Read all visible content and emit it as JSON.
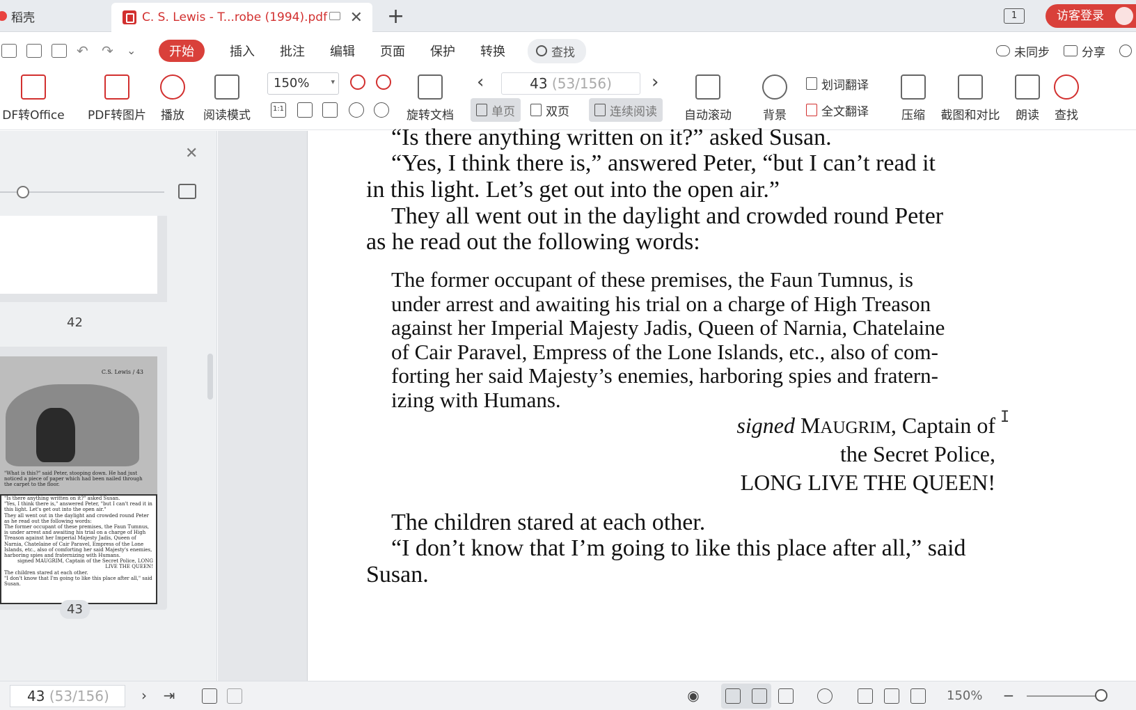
{
  "tabs": {
    "home_label": "稻壳",
    "doc_label": "C. S. Lewis - T...robe (1994).pdf",
    "new_tab_symbol": "+"
  },
  "account": {
    "login_label": "访客登录",
    "layout_badge": "1"
  },
  "menu": {
    "items": [
      "开始",
      "插入",
      "批注",
      "编辑",
      "页面",
      "保护",
      "转换"
    ],
    "search_label": "查找",
    "sync_label": "未同步",
    "share_label": "分享"
  },
  "toolbar": {
    "pdf_to_office": "DF转Office",
    "pdf_to_image": "PDF转图片",
    "play": "播放",
    "reading_mode": "阅读模式",
    "zoom_value": "150%",
    "rotate_doc": "旋转文档",
    "page_current": "43",
    "page_total": "(53/156)",
    "single_page": "单页",
    "double_page": "双页",
    "continuous": "连续阅读",
    "auto_scroll": "自动滚动",
    "background": "背景",
    "word_translate": "划词翻译",
    "full_translate": "全文翻译",
    "compress": "压缩",
    "screenshot_compare": "截图和对比",
    "read_aloud": "朗读",
    "find": "查找"
  },
  "sidebar": {
    "page_42_label": "42",
    "page_43_label": "43",
    "thumb_header": "C.S. Lewis / 43",
    "thumb_caption": "\"What is this?\" said Peter, stooping down. He had just noticed a piece of paper which had been nailed through the carpet to the floor.",
    "thumb_lines": [
      "\"Is there anything written on it?\" asked Susan.",
      "\"Yes, I think there is,\" answered Peter, \"but I can't read it in this light. Let's get out into the open air.\"",
      "They all went out in the daylight and crowded round Peter as he read out the following words:",
      "The former occupant of these premises, the Faun Tumnus, is under arrest and awaiting his trial on a charge of High Treason against her Imperial Majesty Jadis, Queen of Narnia, Chatelaine of Cair Paravel, Empress of the Lone Islands, etc., also of comforting her said Majesty's enemies, harboring spies and fraternizing with Humans.",
      "signed MAUGRIM, Captain of the Secret Police, LONG LIVE THE QUEEN!",
      "The children stared at each other.",
      "\"I don't know that I'm going to like this place after all,\" said Susan."
    ]
  },
  "document": {
    "p1": "“Is there anything written on it?” asked Susan.",
    "p2a": "“Yes, I think there is,” answered Peter, “but I can’t read it",
    "p2b": "in this light. Let’s get out into the open air.”",
    "p3a": "They all went out in the daylight and crowded round Peter",
    "p3b": "as he read out the following words:",
    "notice": [
      "The former occupant of these premises, the Faun Tumnus, is",
      "under arrest and awaiting his trial on a charge of High Treason",
      "against her Imperial Majesty Jadis, Queen of Narnia, Chatelaine",
      "of Cair Paravel, Empress of the Lone Islands, etc., also of com-",
      "forting her said Majesty’s enemies, harboring spies and fratern-",
      "izing with Humans."
    ],
    "sig_signed": "signed",
    "sig_name_cap": "M",
    "sig_name_rest": "AUGRIM",
    "sig_title": ", Captain of",
    "sig_line2": "the Secret Police,",
    "sig_line3": "LONG LIVE THE QUEEN!",
    "p4": "The children stared at each other.",
    "p5a": "“I don’t know that I’m going to like this place after all,” said",
    "p5b": "Susan."
  },
  "statusbar": {
    "page_current": "43",
    "page_total": "(53/156)",
    "zoom_label": "150%"
  },
  "colors": {
    "accent": "#d9403a",
    "pdf_red": "#d2302f"
  }
}
